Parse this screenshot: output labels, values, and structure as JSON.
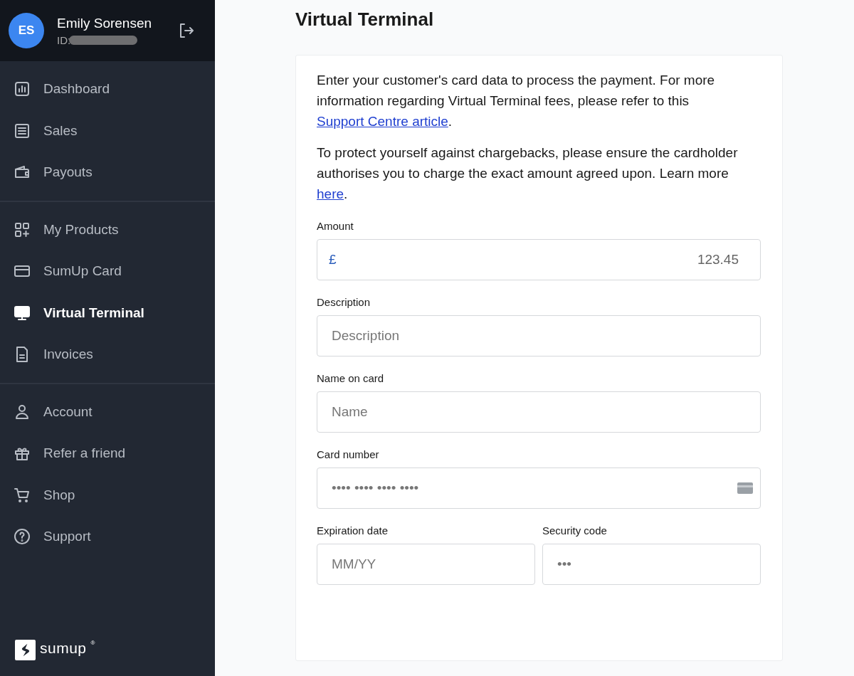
{
  "user": {
    "initials": "ES",
    "name": "Emily Sorensen",
    "id_label": "ID:"
  },
  "nav_groups": [
    {
      "items": [
        {
          "label": "Dashboard",
          "selected": false
        },
        {
          "label": "Sales",
          "selected": false
        },
        {
          "label": "Payouts",
          "selected": false
        }
      ]
    },
    {
      "items": [
        {
          "label": "My Products",
          "selected": false
        },
        {
          "label": "SumUp Card",
          "selected": false
        },
        {
          "label": "Virtual Terminal",
          "selected": true
        },
        {
          "label": "Invoices",
          "selected": false
        }
      ]
    },
    {
      "items": [
        {
          "label": "Account",
          "selected": false
        },
        {
          "label": "Refer a friend",
          "selected": false
        },
        {
          "label": "Shop",
          "selected": false
        },
        {
          "label": "Support",
          "selected": false
        }
      ]
    }
  ],
  "logo": {
    "wordmark": "sumup",
    "mark": "®"
  },
  "page_title": "Virtual Terminal",
  "paragraphs": [
    [
      {
        "text": "Enter your customer's card data to process the payment. For more information regarding Virtual Terminal fees, please refer to this "
      },
      {
        "link": "Support Centre article"
      },
      {
        "text": "."
      }
    ],
    [
      {
        "text": "To protect yourself against chargebacks, please ensure the cardholder authorises you to charge the exact amount agreed upon. Learn more "
      },
      {
        "link": "here"
      },
      {
        "text": "."
      }
    ]
  ],
  "form_rows": [
    [
      {
        "kind": "amount",
        "label": "Amount",
        "prefix": "£",
        "value": "123.45"
      }
    ],
    [
      {
        "kind": "text",
        "label": "Description",
        "placeholder": "Description"
      }
    ],
    [
      {
        "kind": "text",
        "label": "Name on card",
        "placeholder": "Name"
      }
    ],
    [
      {
        "kind": "card",
        "label": "Card number",
        "placeholder": "•••• •••• •••• ••••"
      }
    ],
    [
      {
        "kind": "text",
        "label": "Expiration date",
        "placeholder": "MM/YY"
      },
      {
        "kind": "text",
        "label": "Security code",
        "placeholder": "•••"
      }
    ]
  ]
}
